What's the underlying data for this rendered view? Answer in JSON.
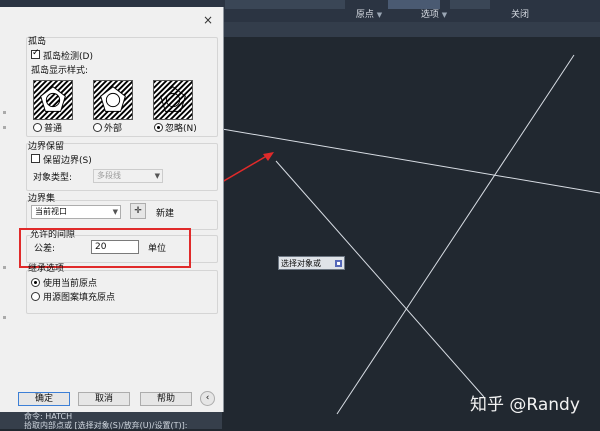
{
  "ribbon": {
    "tabs": [
      {
        "label": "原点",
        "arrow": "▼"
      },
      {
        "label": "选项",
        "arrow": "▼"
      },
      {
        "label": "关闭",
        "arrow": ""
      }
    ]
  },
  "dialog": {
    "close_glyph": "×",
    "islands": {
      "title": "孤岛",
      "detect_label": "孤岛检测(D)",
      "style_label": "孤岛显示样式:",
      "options": [
        "普通",
        "外部",
        "忽略(N)"
      ]
    },
    "boundary_retain": {
      "title": "边界保留",
      "retain_label": "保留边界(S)",
      "object_type_label": "对象类型:",
      "object_type_value": "多段线"
    },
    "boundary_set": {
      "title": "边界集",
      "value": "当前视口",
      "new_label": "新建"
    },
    "gap_tolerance": {
      "title": "允许的间隙",
      "tolerance_label": "公差:",
      "tolerance_value": "20",
      "unit_label": "单位"
    },
    "inherit": {
      "title": "继承选项",
      "options": [
        "使用当前原点",
        "用源图案填充原点"
      ]
    },
    "buttons": {
      "ok": "确定",
      "cancel": "取消",
      "help": "帮助"
    }
  },
  "canvas": {
    "tooltip": "选择对象或"
  },
  "command_line": {
    "line1": "命令: HATCH",
    "line2": "拾取内部点或 [选择对象(S)/放弃(U)/设置(T)]:"
  },
  "watermark": "知乎 @Randy",
  "colors": {
    "annotation_red": "#e02a2a",
    "canvas_bg": "#212830",
    "line_color": "#d8dde4"
  }
}
